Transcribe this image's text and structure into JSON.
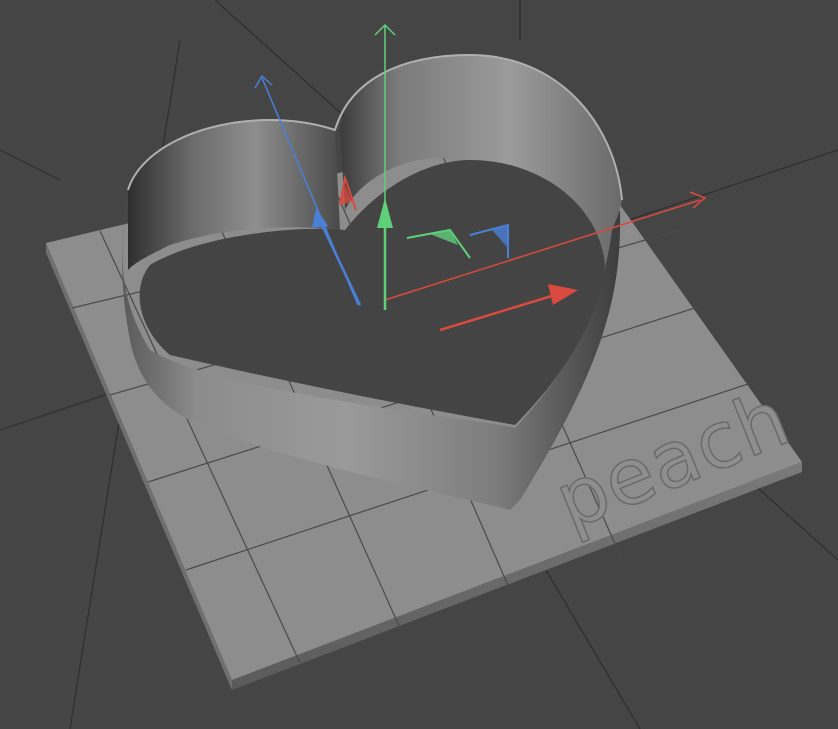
{
  "viewport": {
    "background": "#454545",
    "grid_color": "#2f2f2f"
  },
  "model": {
    "name": "heart-cookie-cutter",
    "wall_color": "#8a8a8a",
    "base_color": "#8f8f8f",
    "embossed_text": "peach"
  },
  "gizmo": {
    "x_axis_color": "#d94a3f",
    "y_axis_color": "#5fd07a",
    "z_axis_color": "#4a7fd6",
    "icons": [
      "move-arrow-x-icon",
      "move-arrow-y-icon",
      "move-arrow-z-icon",
      "plane-handle-xy-icon",
      "plane-handle-yz-icon",
      "plane-handle-xz-icon"
    ]
  }
}
